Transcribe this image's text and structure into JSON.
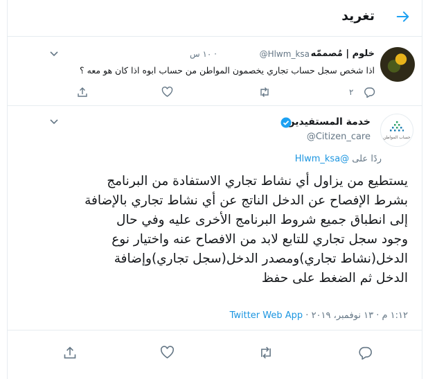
{
  "header": {
    "title": "تغريد",
    "back_icon": "arrow-right-icon"
  },
  "reply_tweet": {
    "name": "خلوم | مُصممّه",
    "handle": "@Hlwm_ksa",
    "time": "· ١٠ س",
    "text": "اذا شخص سجل حساب تجاري يخصمون المواطن من حساب ابوه اذا كان هو معه ؟",
    "reply_count": "٢"
  },
  "main_tweet": {
    "name": "خدمة المستفيدين",
    "handle": "@Citizen_care",
    "avatar_text": "حساب المواطن",
    "reply_prefix": "ردًا على ",
    "reply_mention": "@Hlwm_ksa",
    "lines": [
      "يستطيع من يزاول أي نشاط تجاري الاستفادة من البرنامج",
      "بشرط الإفصاح عن الدخل الناتج عن أي نشاط تجاري بالإضافة",
      "إلى انطباق جميع شروط البرنامج الأخرى عليه وفي حال",
      "وجود سجل تجاري للتابع لابد من الافصاح عنه واختيار نوع",
      "الدخل(نشاط تجاري)ومصدر الدخل(سجل تجاري)وإضافة",
      "الدخل ثم الضغط على حفظ"
    ],
    "time": "١:١٢ م · ١٣ نوفمبر، ٢٠١٩ · ",
    "app": "Twitter Web App"
  },
  "colors": {
    "accent": "#1da1f2",
    "link": "#1b95e0",
    "muted": "#657786",
    "border": "#e6ecf0"
  }
}
